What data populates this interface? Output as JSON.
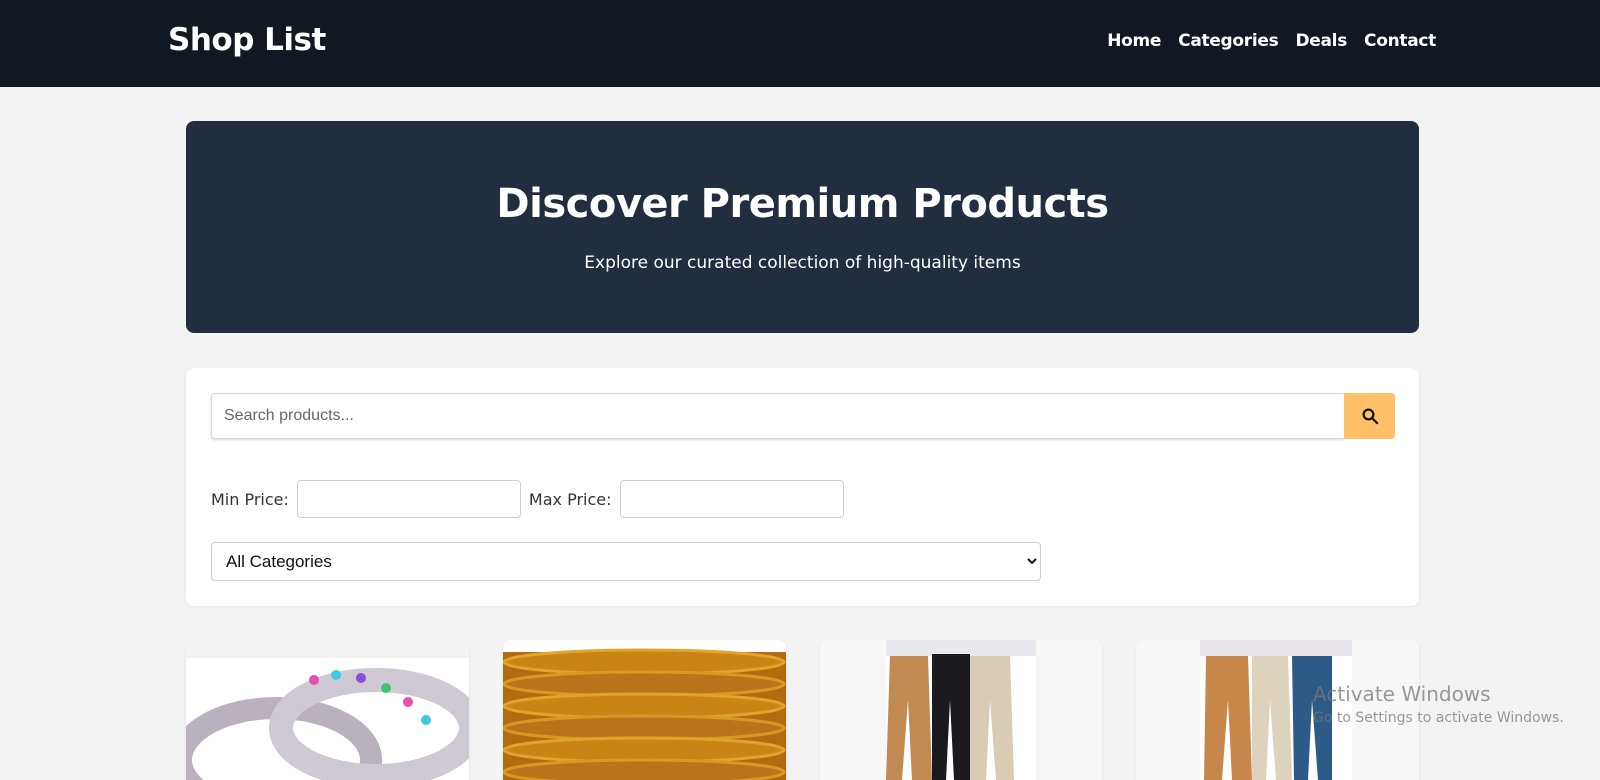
{
  "header": {
    "brand": "Shop List",
    "nav": [
      "Home",
      "Categories",
      "Deals",
      "Contact"
    ]
  },
  "hero": {
    "title": "Discover Premium Products",
    "subtitle": "Explore our curated collection of high-quality items"
  },
  "filters": {
    "search_placeholder": "Search products...",
    "search_value": "",
    "min_price_label": "Min Price:",
    "min_price_value": "",
    "max_price_label": "Max Price:",
    "max_price_value": "",
    "category_selected": "All Categories",
    "search_icon": "search-icon",
    "accent_color": "#ffc067"
  },
  "products": [
    {
      "image": "crystal-bangles-image"
    },
    {
      "image": "gold-bangles-image"
    },
    {
      "image": "chino-trousers-image"
    },
    {
      "image": "mens-pants-image"
    }
  ],
  "watermark": {
    "line1": "Activate Windows",
    "line2": "Go to Settings to activate Windows."
  },
  "colors": {
    "topbar": "#111822",
    "hero": "#222d3f",
    "page": "#f3f3f3"
  }
}
